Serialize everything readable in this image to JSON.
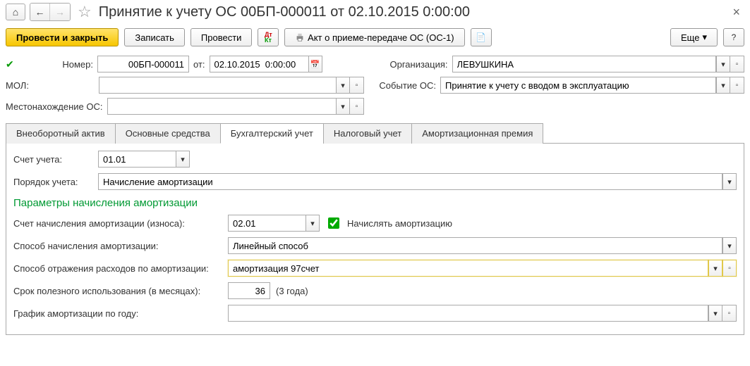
{
  "header": {
    "title": "Принятие к учету ОС 00БП-000011 от 02.10.2015 0:00:00"
  },
  "toolbar": {
    "post_close": "Провести и закрыть",
    "save": "Записать",
    "post": "Провести",
    "act_print": "Акт о приеме-передаче ОС (ОС-1)",
    "more": "Еще"
  },
  "fields": {
    "number_label": "Номер:",
    "number_value": "00БП-000011",
    "from_label": "от:",
    "date_value": "02.10.2015  0:00:00",
    "org_label": "Организация:",
    "org_value": "ЛЕВУШКИНА",
    "mol_label": "МОЛ:",
    "mol_value": "",
    "event_label": "Событие ОС:",
    "event_value": "Принятие к учету с вводом в эксплуатацию",
    "location_label": "Местонахождение ОС:",
    "location_value": ""
  },
  "tabs": {
    "t0": "Внеоборотный актив",
    "t1": "Основные средства",
    "t2": "Бухгалтерский учет",
    "t3": "Налоговый учет",
    "t4": "Амортизационная премия"
  },
  "acc": {
    "account_label": "Счет учета:",
    "account_value": "01.01",
    "order_label": "Порядок учета:",
    "order_value": "Начисление амортизации",
    "section_title": "Параметры начисления амортизации",
    "depr_account_label": "Счет начисления амортизации (износа):",
    "depr_account_value": "02.01",
    "compute_depr_label": "Начислять амортизацию",
    "method_label": "Способ начисления амортизации:",
    "method_value": "Линейный способ",
    "expense_label": "Способ отражения расходов по амортизации:",
    "expense_value": "амортизация 97счет",
    "life_label": "Срок полезного использования (в месяцах):",
    "life_value": "36",
    "life_hint": "(3 года)",
    "schedule_label": "График амортизации по году:",
    "schedule_value": ""
  }
}
